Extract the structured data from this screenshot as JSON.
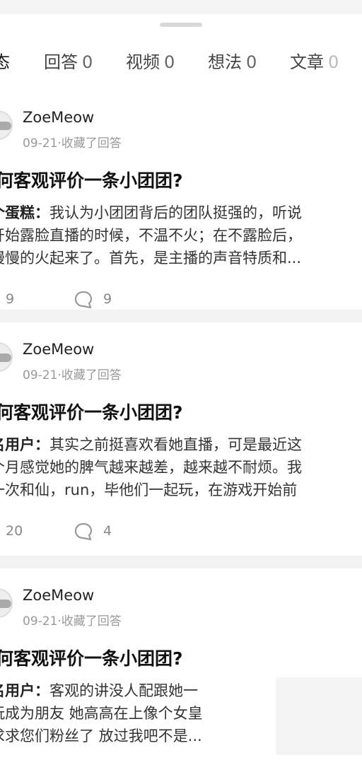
{
  "tabs": [
    {
      "label": "态",
      "count": ""
    },
    {
      "label": "回答",
      "count": "0"
    },
    {
      "label": "视频",
      "count": "0"
    },
    {
      "label": "想法",
      "count": "0"
    },
    {
      "label": "文章",
      "count": "0"
    }
  ],
  "colors": {
    "accent": "#0066ff"
  },
  "feed": [
    {
      "user": "ZoeMeow",
      "meta": "09-21·收藏了回答",
      "title": "何客观评价一条小团团?",
      "author": "个蛋糕：",
      "lines": [
        "我认为小团团背后的团队挺强的，听说",
        "开始露脸直播的时候，不温不火；在不露脸后，",
        "慢慢的火起来了。首先，是主播的声音特质和..."
      ],
      "likes": "9",
      "comments": "9"
    },
    {
      "user": "ZoeMeow",
      "meta": "09-21·收藏了回答",
      "title": "何客观评价一条小团团?",
      "author": "名用户：",
      "lines": [
        "其实之前挺喜欢看她直播，可是最近这",
        "个月感觉她的脾气越来越差，越来越不耐烦。我",
        "一次和仙，run，毕他们一起玩，在游戏开始前"
      ],
      "likes": "20",
      "comments": "4"
    },
    {
      "user": "ZoeMeow",
      "meta": "09-21·收藏了回答",
      "title": "何客观评价一条小团团?",
      "author": "名用户：",
      "lines": [
        "客观的讲没人配跟她一",
        "玩成为朋友 她高高在上像个女皇",
        "求求您们粉丝了 放过我吧不是..."
      ]
    }
  ]
}
